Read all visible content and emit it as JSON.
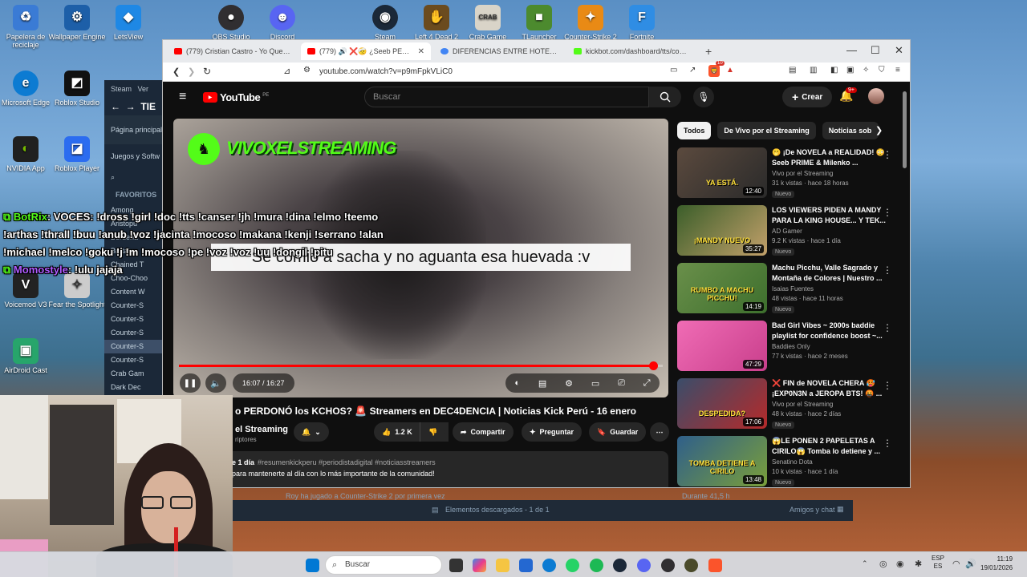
{
  "desktop_icons": [
    {
      "label": "Papelera de reciclaje",
      "color": "#3a7bd5"
    },
    {
      "label": "Wallpaper Engine",
      "color": "#1d5fa8"
    },
    {
      "label": "LetsView",
      "color": "#1e88e5"
    },
    {
      "label": "OBS Studio",
      "color": "#302e31"
    },
    {
      "label": "Discord",
      "color": "#5865f2"
    },
    {
      "label": "Steam",
      "color": "#1b2838"
    },
    {
      "label": "Left 4 Dead 2",
      "color": "#6b4b1e"
    },
    {
      "label": "Crab Game",
      "color": "#d9d4c8"
    },
    {
      "label": "TLauncher",
      "color": "#4c8a2e"
    },
    {
      "label": "Counter-Strike 2",
      "color": "#e98a15"
    },
    {
      "label": "Fortnite",
      "color": "#2f8de4"
    },
    {
      "label": "Microsoft Edge",
      "color": "#0c7bd2"
    },
    {
      "label": "Roblox Studio",
      "color": "#111"
    },
    {
      "label": "NVIDIA App",
      "color": "#202020"
    },
    {
      "label": "Roblox Player",
      "color": "#2b6cf0"
    },
    {
      "label": "Voicemod V3",
      "color": "#222"
    },
    {
      "label": "Fear the Spotlight",
      "color": "#ccc"
    },
    {
      "label": "AirDroid Cast",
      "color": "#27a56b"
    }
  ],
  "steam": {
    "menu": [
      "Steam",
      "Ver"
    ],
    "title": "TIE",
    "nav": [
      "Página principal",
      "Juegos y Softw"
    ],
    "favorites": "FAVORITOS",
    "items": [
      "Among",
      "Aristopu",
      "Borderla",
      "Brotato",
      "Chained T",
      "Choo-Choo",
      "Content W",
      "Counter-S",
      "Counter-S",
      "Counter-S",
      "Counter-S",
      "Counter-S",
      "Crab Gam",
      "Dark Dec"
    ],
    "bottom_activity": "Roy ha jugado a  Counter-Strike 2 por primera vez",
    "bottom_playtime": "Durante 41,5 h",
    "downloads": "Elementos descargados - 1 de 1",
    "friends": "Amigos y chat"
  },
  "browser": {
    "tabs": [
      {
        "label": "(779) Cristian Castro - Yo Quería - Yo",
        "icon": "#ff0000",
        "active": false
      },
      {
        "label": "(779) 🔊 ❌🤕 ¿Seeb PERDONÓ",
        "icon": "#ff0000",
        "active": true
      },
      {
        "label": "DIFERENCIAS ENTRE HOTEL Y HOSTA",
        "icon": "#4285f4",
        "active": false
      },
      {
        "label": "kickbot.com/dashboard/tts/comman",
        "icon": "#53fc18",
        "active": false
      }
    ],
    "url": "youtube.com/watch?v=p9mFpkVLiC0",
    "brave_badge": "10"
  },
  "youtube": {
    "logo_text": "YouTube",
    "logo_country": "PE",
    "search_placeholder": "Buscar",
    "create_label": "Crear",
    "notif_count": "9+",
    "chips": [
      "Todos",
      "De Vivo por el Streaming",
      "Noticias sob"
    ],
    "video": {
      "watermark": "VIVOXELSTREAMING",
      "subtitle": "Se comió a sacha y no aguanta esa huevada :v",
      "time": "16:07 / 16:27",
      "progress": 0.9797,
      "title": "o PERDONÓ los KCHOS? 🚨 Streamers en DEC4DENCIA | Noticias Kick Perú - 16 enero",
      "channel": "el Streaming",
      "subs": "riptores",
      "likes": "1.2 K",
      "share": "Compartir",
      "ask": "Preguntar",
      "save": "Guardar",
      "desc_meta": "e 1 día",
      "hashtags": "#resumenkickperu #periodistadigital #noticiasstreamers",
      "desc_text": "para mantenerte al día con lo más importante de la comunidad!"
    },
    "recommendations": [
      {
        "title": "🫢 ¡De NOVELA a REALIDAD! 😳 Seeb PRIME & Milenko ...",
        "channel": "Vivo por el Streaming",
        "meta": "31 k vistas · hace 18 horas",
        "badge": "Nuevo",
        "duration": "12:40",
        "thumb_text": "YA ESTÁ.",
        "colors": [
          "#5b4a3e",
          "#2a2a2a"
        ]
      },
      {
        "title": "LOS VIEWERS PIDEN A MANDY PARA LA KING HOUSE... Y TEK...",
        "channel": "AD Gamer",
        "meta": "9.2 K vistas · hace 1 día",
        "badge": "Nuevo",
        "duration": "35:27",
        "thumb_text": "¡MANDY NUEVO",
        "colors": [
          "#3b5e2a",
          "#c2a06a"
        ]
      },
      {
        "title": "Machu Picchu, Valle Sagrado y Montaña de Colores | Nuestro ...",
        "channel": "Isaias Fuentes",
        "meta": "48 vistas · hace 11 horas",
        "badge": "Nuevo",
        "duration": "14:19",
        "thumb_text": "RUMBO A MACHU PICCHU!",
        "colors": [
          "#6a8f4a",
          "#3d6f2d"
        ]
      },
      {
        "title": "Bad Girl Vibes ~ 2000s baddie playlist for confidence boost ~...",
        "channel": "Baddies Only",
        "meta": "77 k vistas · hace 2 meses",
        "badge": "",
        "duration": "47:29",
        "thumb_text": "",
        "colors": [
          "#f06cb5",
          "#c93f8c"
        ]
      },
      {
        "title": "❌ FIN de NOVELA CHERA 🥵 ¡EXP0N3N a JEROPA BTS! 🤬 ...",
        "channel": "Vivo por el Streaming",
        "meta": "48 k vistas · hace 2 días",
        "badge": "Nuevo",
        "duration": "17:06",
        "thumb_text": "DESPEDIDA?",
        "colors": [
          "#3a4d6a",
          "#b52a2a"
        ]
      },
      {
        "title": "😱LE PONEN 2 PAPELETAS A CIRILO😱 Tomba lo detiene y ...",
        "channel": "Senatino Dota",
        "meta": "10 k vistas · hace 1 día",
        "badge": "Nuevo",
        "duration": "13:48",
        "thumb_text": "TOMBA DETIENE A CIRILO",
        "colors": [
          "#2f5f8a",
          "#7a9f3a"
        ]
      }
    ]
  },
  "chat_overlay": {
    "line1_user": "BotRix",
    "line1_text": ": VOCES: !dross !girl !doc !tts !canser !jh !mura !dina !elmo !teemo",
    "line2": "!arthas !thrall !buu !anub !voz !jacinta !mocoso !makana !kenji !serrano !alan",
    "line3": "!michael !melco !goku !j !m !mocoso !pe !voz !voz !uu !dongil !pitu",
    "line4_user": "Momostyle",
    "line4_text": ": !ulu jajaja"
  },
  "taskbar": {
    "search": "Buscar",
    "lang1": "ESP",
    "lang2": "ES",
    "time": "11:19",
    "date": "19/01/2026"
  }
}
